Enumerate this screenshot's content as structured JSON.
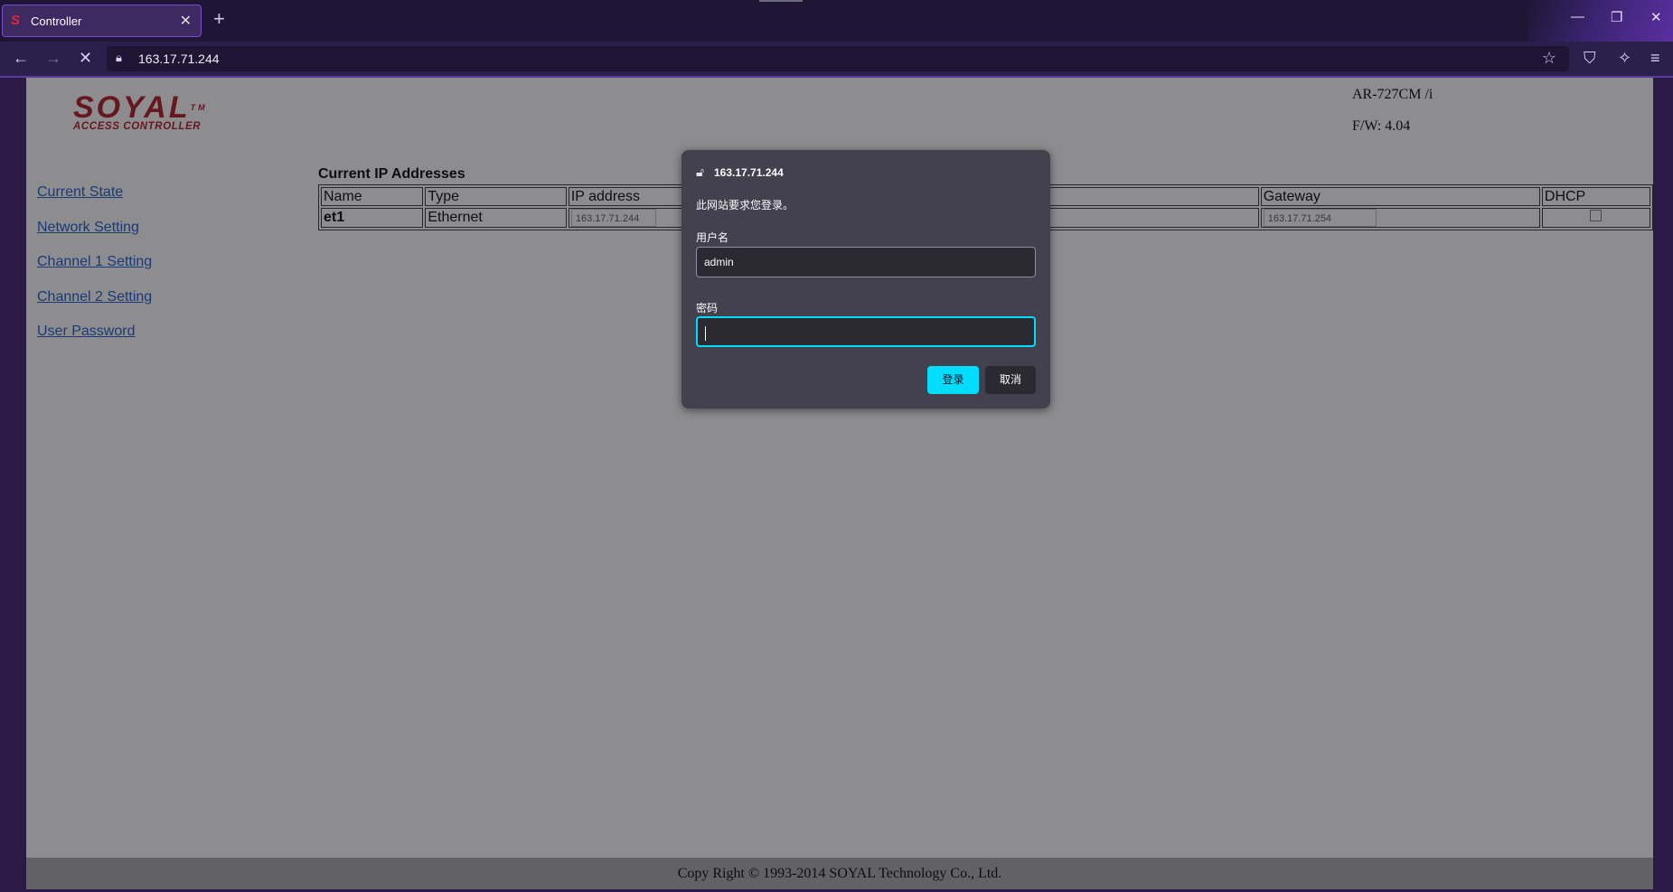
{
  "browser": {
    "tab_title": "Controller",
    "tab_favicon": "S",
    "url": "163.17.71.244"
  },
  "page": {
    "logo_text": "SOYAL",
    "logo_tm": "TM",
    "logo_subtitle": "ACCESS CONTROLLER",
    "model": "AR-727CM /i",
    "firmware": "F/W: 4.04",
    "nav": [
      "Current State",
      "Network Setting",
      "Channel 1 Setting",
      "Channel 2 Setting",
      "User Password"
    ],
    "table_title": "Current IP Addresses",
    "headers": [
      "Name",
      "Type",
      "IP address",
      "",
      "Gateway",
      "DHCP"
    ],
    "row": {
      "name": "et1",
      "type": "Ethernet",
      "ip": "163.17.71.244",
      "gateway": "163.17.71.254",
      "dhcp": false
    },
    "footer": "Copy Right © 1993-2014 SOYAL Technology Co., Ltd."
  },
  "dialog": {
    "host": "163.17.71.244",
    "message": "此网站要求您登录。",
    "username_label": "用户名",
    "username_value": "admin",
    "password_label": "密码",
    "password_value": "",
    "login_label": "登录",
    "cancel_label": "取消"
  },
  "colors": {
    "accent": "#00ddff",
    "dialog_bg": "#42414d",
    "tab_border": "#7c4dcc",
    "link": "#1a57c8",
    "logo": "#b3121b"
  },
  "icons": [
    "back-arrow-icon",
    "forward-arrow-icon",
    "stop-icon",
    "lock-icon",
    "bookmark-star-icon",
    "shield-icon",
    "extension-icon",
    "menu-icon",
    "close-icon",
    "plus-icon",
    "minimize-icon",
    "restore-icon",
    "window-close-icon"
  ]
}
